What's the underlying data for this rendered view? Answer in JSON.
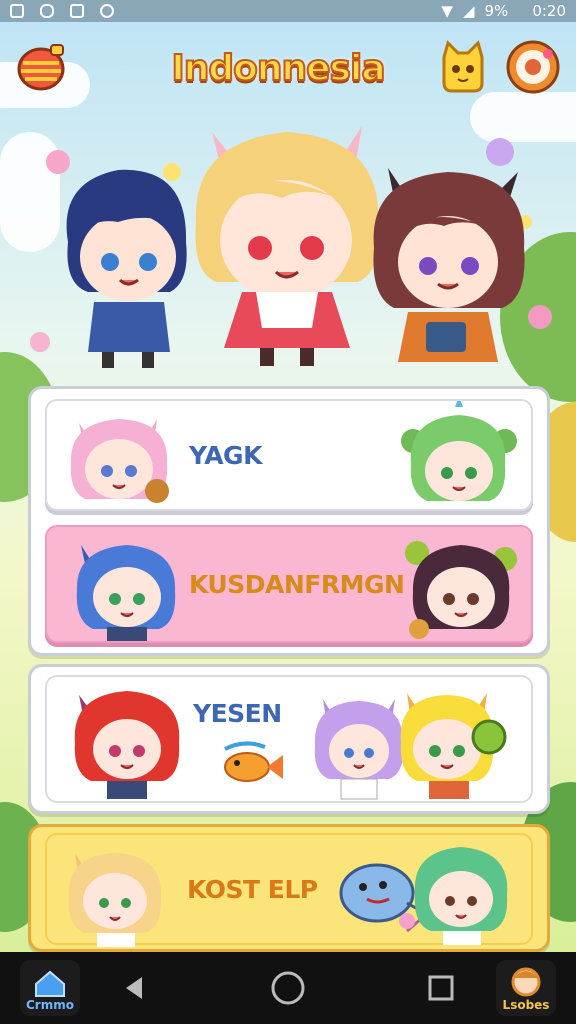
{
  "status": {
    "battery": "9%",
    "time": "0:20"
  },
  "app": {
    "title": "Indonnesia"
  },
  "header": {
    "left_icon": "lantern-icon",
    "right_icon_1": "cat-face-icon",
    "right_icon_2": "donut-icon"
  },
  "menu": {
    "item1": {
      "label": "YAGK"
    },
    "item2": {
      "label": "KUSDANFRMGN"
    },
    "item3": {
      "label": "YESEN"
    },
    "item4": {
      "label": "KOST ELP"
    }
  },
  "nav": {
    "left_label": "Crmmo",
    "right_label": "Lsobes"
  },
  "colors": {
    "title_fill": "#ffd84a",
    "title_stroke": "#c35a1c",
    "pink_card": "#f9b7d2",
    "yellow_card": "#fbe57a",
    "label_gold": "#d98a17",
    "label_blue": "#3d67b3"
  }
}
